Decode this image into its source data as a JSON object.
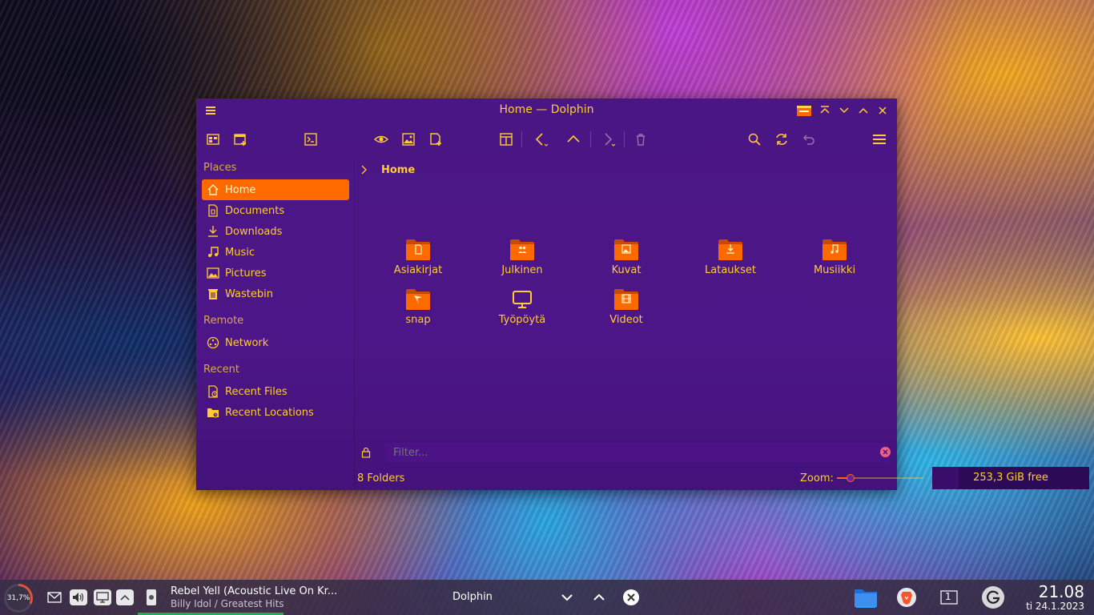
{
  "window": {
    "title": "Home — Dolphin"
  },
  "sidebar": {
    "sections": [
      {
        "title": "Places"
      },
      {
        "title": "Remote"
      },
      {
        "title": "Recent"
      }
    ],
    "places": [
      {
        "label": "Home",
        "icon": "home-icon",
        "active": true
      },
      {
        "label": "Documents",
        "icon": "documents-icon"
      },
      {
        "label": "Downloads",
        "icon": "downloads-icon"
      },
      {
        "label": "Music",
        "icon": "music-icon"
      },
      {
        "label": "Pictures",
        "icon": "pictures-icon"
      },
      {
        "label": "Wastebin",
        "icon": "wastebin-icon"
      }
    ],
    "remote": [
      {
        "label": "Network",
        "icon": "network-icon"
      }
    ],
    "recent": [
      {
        "label": "Recent Files",
        "icon": "recent-files-icon"
      },
      {
        "label": "Recent Locations",
        "icon": "recent-locations-icon"
      }
    ]
  },
  "breadcrumb": {
    "current": "Home"
  },
  "folders": [
    {
      "name": "Asiakirjat",
      "icon": "documents-folder-icon"
    },
    {
      "name": "Julkinen",
      "icon": "public-folder-icon"
    },
    {
      "name": "Kuvat",
      "icon": "pictures-folder-icon"
    },
    {
      "name": "Lataukset",
      "icon": "downloads-folder-icon"
    },
    {
      "name": "Musiikki",
      "icon": "music-folder-icon"
    },
    {
      "name": "snap",
      "icon": "snap-folder-icon"
    },
    {
      "name": "Työpöytä",
      "icon": "desktop-icon"
    },
    {
      "name": "Videot",
      "icon": "videos-folder-icon"
    }
  ],
  "filter": {
    "placeholder": "Filter..."
  },
  "status": {
    "count": "8 Folders",
    "zoom_label": "Zoom:",
    "zoom_level": 0.16,
    "free_space": "253,3 GiB free",
    "free_fill": 0.17
  },
  "taskbar": {
    "cpu_load": "31,7%",
    "media": {
      "title": "Rebel Yell (Acoustic Live On Kr...",
      "subtitle": "Billy Idol / Greatest Hits"
    },
    "active_task": "Dolphin",
    "pager": "1",
    "clock": {
      "time": "21.08",
      "date": "ti 24.1.2023"
    }
  },
  "colors": {
    "accent": "#ff6a00",
    "text": "#ffcc33",
    "window_bg": "#4a1683"
  }
}
